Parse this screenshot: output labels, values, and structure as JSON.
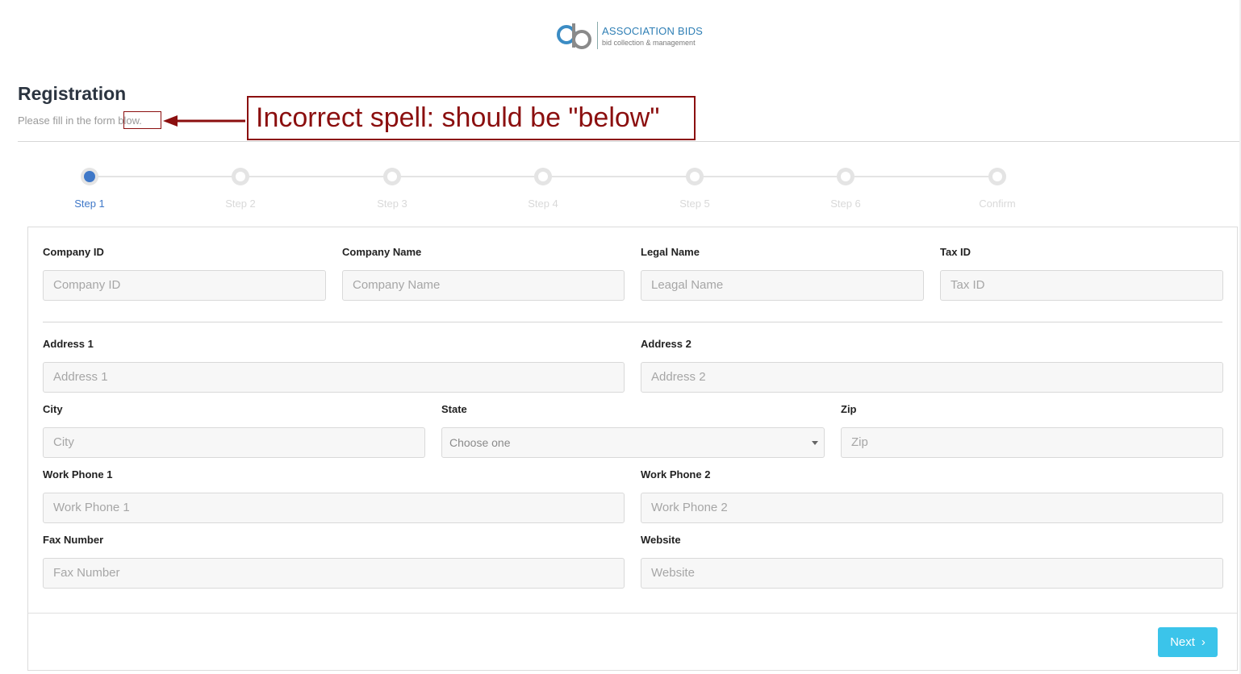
{
  "logo": {
    "name": "ASSOCIATION BIDS",
    "tagline": "bid collection & management"
  },
  "header": {
    "title": "Registration",
    "subtitle": "Please fill in the form blow."
  },
  "annotation": {
    "text": "Incorrect spell: should be \"below\"",
    "color": "#8b0f0f"
  },
  "steps": [
    {
      "label": "Step 1",
      "active": true
    },
    {
      "label": "Step 2",
      "active": false
    },
    {
      "label": "Step 3",
      "active": false
    },
    {
      "label": "Step 4",
      "active": false
    },
    {
      "label": "Step 5",
      "active": false
    },
    {
      "label": "Step 6",
      "active": false
    },
    {
      "label": "Confirm",
      "active": false
    }
  ],
  "form": {
    "company_id": {
      "label": "Company ID",
      "placeholder": "Company ID"
    },
    "company_name": {
      "label": "Company Name",
      "placeholder": "Company Name"
    },
    "legal_name": {
      "label": "Legal Name",
      "placeholder": "Leagal Name"
    },
    "tax_id": {
      "label": "Tax ID",
      "placeholder": "Tax ID"
    },
    "address1": {
      "label": "Address 1",
      "placeholder": "Address 1"
    },
    "address2": {
      "label": "Address 2",
      "placeholder": "Address 2"
    },
    "city": {
      "label": "City",
      "placeholder": "City"
    },
    "state": {
      "label": "State",
      "value": "Choose one"
    },
    "zip": {
      "label": "Zip",
      "placeholder": "Zip"
    },
    "work_phone1": {
      "label": "Work Phone 1",
      "placeholder": "Work Phone 1"
    },
    "work_phone2": {
      "label": "Work Phone 2",
      "placeholder": "Work Phone 2"
    },
    "fax": {
      "label": "Fax Number",
      "placeholder": "Fax Number"
    },
    "website": {
      "label": "Website",
      "placeholder": "Website"
    }
  },
  "actions": {
    "next_label": "Next",
    "next_icon": "chevron-right-icon",
    "next_color": "#3bc4ea"
  },
  "colors": {
    "accent": "#3f78c8",
    "inactive_step": "#e4e4e4"
  }
}
